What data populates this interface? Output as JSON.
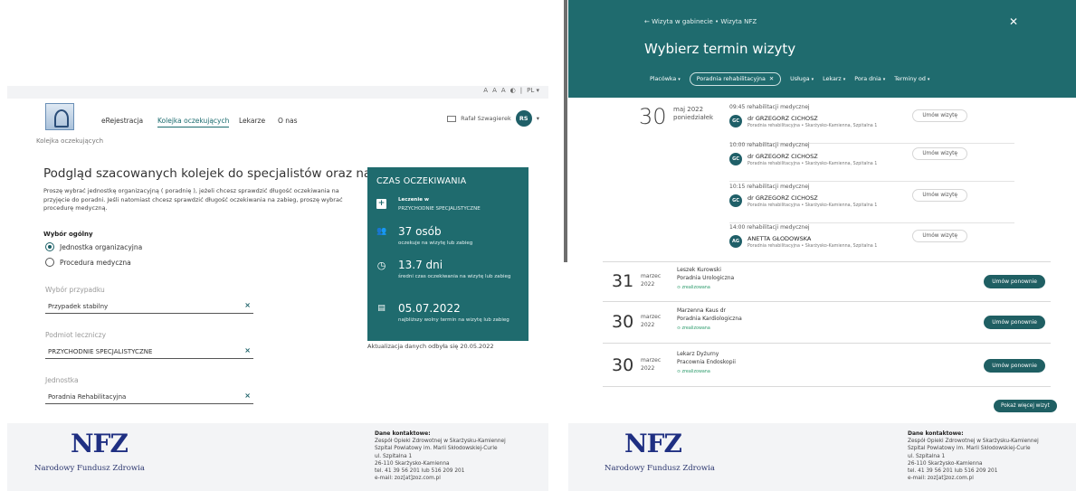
{
  "left": {
    "access": {
      "a1": "A",
      "a2": "A",
      "a3": "A",
      "contrast_icon": "contrast-icon",
      "lang": "PL ▾"
    },
    "nav": {
      "links": [
        "eRejestracja",
        "Kolejka oczekujących",
        "Lekarze",
        "O nas"
      ],
      "user_name": "Rafał Szwagierek",
      "user_initials": "RS",
      "caret": "▾"
    },
    "breadcrumb": "Kolejka oczekujących",
    "title": "Podgląd szacowanych kolejek do specjalistów oraz na zabiegi.",
    "description": "Proszę wybrać jednostkę organizacyjną ( poradnię ), jeżeli chcesz sprawdzić długość oczekiwania na przyjęcie do poradni. Jeśli natomiast chcesz sprawdzić długość oczekiwania na zabieg, proszę wybrać procedurę medyczną.",
    "general_heading": "Wybór ogólny",
    "radio_options": [
      "Jednostka organizacyjna",
      "Procedura medyczna"
    ],
    "fields": [
      {
        "label": "Wybór przypadku",
        "value": "Przypadek stabilny"
      },
      {
        "label": "Podmiot leczniczy",
        "value": "PRZYCHODNIE SPECJALISTYCZNE"
      },
      {
        "label": "Jednostka",
        "value": "Poradnia Rehabilitacyjna"
      }
    ],
    "clear_symbol": "×",
    "wait_box": {
      "title": "CZAS OCZEKIWANIA",
      "treatment_label": "Leczenie w",
      "treatment_value": "PRZYCHODNIE SPECJALISTYCZNE",
      "people": "37 osób",
      "people_desc": "oczekuje na wizytę lub zabieg",
      "days": "13.7 dni",
      "days_desc": "średni czas oczekiwania na wizytę lub zabieg",
      "date": "05.07.2022",
      "date_desc": "najbliższy wolny termin na wizytę lub zabieg",
      "icons": {
        "cross": "+",
        "people": "👥",
        "clock": "◷",
        "calendar": "▤"
      }
    },
    "update_note": "Aktualizacja danych odbyła się 20.05.2022"
  },
  "footer": {
    "logo": "NFZ",
    "logo_sub": "Narodowy Fundusz Zdrowia",
    "contact_title": "Dane kontaktowe:",
    "contact_lines": [
      "Zespół Opieki Zdrowotnej w Skarżysku-Kamiennej",
      "Szpital Powiatowy im. Marii Skłodowskiej-Curie",
      "ul. Szpitalna 1",
      "26-110 Skarżysko-Kamienna",
      "tel. 41 39 56 201 lub 516 209 201",
      "e-mail: zoz[at]zoz.com.pl"
    ]
  },
  "right": {
    "back": "←  Wizyta w gabinecie • Wizyta NFZ",
    "close": "✕",
    "title": "Wybierz termin wizyty",
    "filters": {
      "placowka": "Placówka",
      "chip": "Poradnia rehabilitacyjna",
      "usluga": "Usługa",
      "lekarz": "Lekarz",
      "pora": "Pora dnia",
      "terminy": "Terminy od",
      "caret": "▾",
      "chip_x": "✕"
    },
    "day": {
      "num": "30",
      "month": "maj 2022",
      "weekday": "poniedziałek"
    },
    "slots": [
      {
        "time": "09:45  rehabilitacji medycznej",
        "initials": "GC",
        "name": "dr GRZEGORZ CICHOSZ",
        "loc": "Poradnia rehabilitacyjna • Skarżysko-Kamienna, Szpitalna 1",
        "btn": "Umów wizytę"
      },
      {
        "time": "10:00  rehabilitacji medycznej",
        "initials": "GC",
        "name": "dr GRZEGORZ CICHOSZ",
        "loc": "Poradnia rehabilitacyjna • Skarżysko-Kamienna, Szpitalna 1",
        "btn": "Umów wizytę"
      },
      {
        "time": "10:15  rehabilitacji medycznej",
        "initials": "GC",
        "name": "dr GRZEGORZ CICHOSZ",
        "loc": "Poradnia rehabilitacyjna • Skarżysko-Kamienna, Szpitalna 1",
        "btn": "Umów wizytę"
      },
      {
        "time": "14:00  rehabilitacji medycznej",
        "initials": "AG",
        "name": "ANETTA GŁODOWSKA",
        "loc": "Poradnia rehabilitacyjna • Skarżysko-Kamienna, Szpitalna 1",
        "btn": "Umów wizytę"
      }
    ],
    "visits": [
      {
        "day": "31",
        "month": "marzec",
        "year": "2022",
        "doctor": "Leszek Kurowski",
        "clinic": "Poradnia Urologiczna",
        "status": "⊙ zrealizowana",
        "btn": "Umów ponownie"
      },
      {
        "day": "30",
        "month": "marzec",
        "year": "2022",
        "doctor": "Marzenna Kaus dr",
        "clinic": "Poradnia Kardiologiczna",
        "status": "⊙ zrealizowana",
        "btn": "Umów ponownie"
      },
      {
        "day": "30",
        "month": "marzec",
        "year": "2022",
        "doctor": "Lekarz Dyżurny",
        "clinic": "Pracownia Endoskopii",
        "status": "⊙ zrealizowana",
        "btn": "Umów ponownie"
      }
    ],
    "more": "Pokaż więcej wizyt"
  }
}
